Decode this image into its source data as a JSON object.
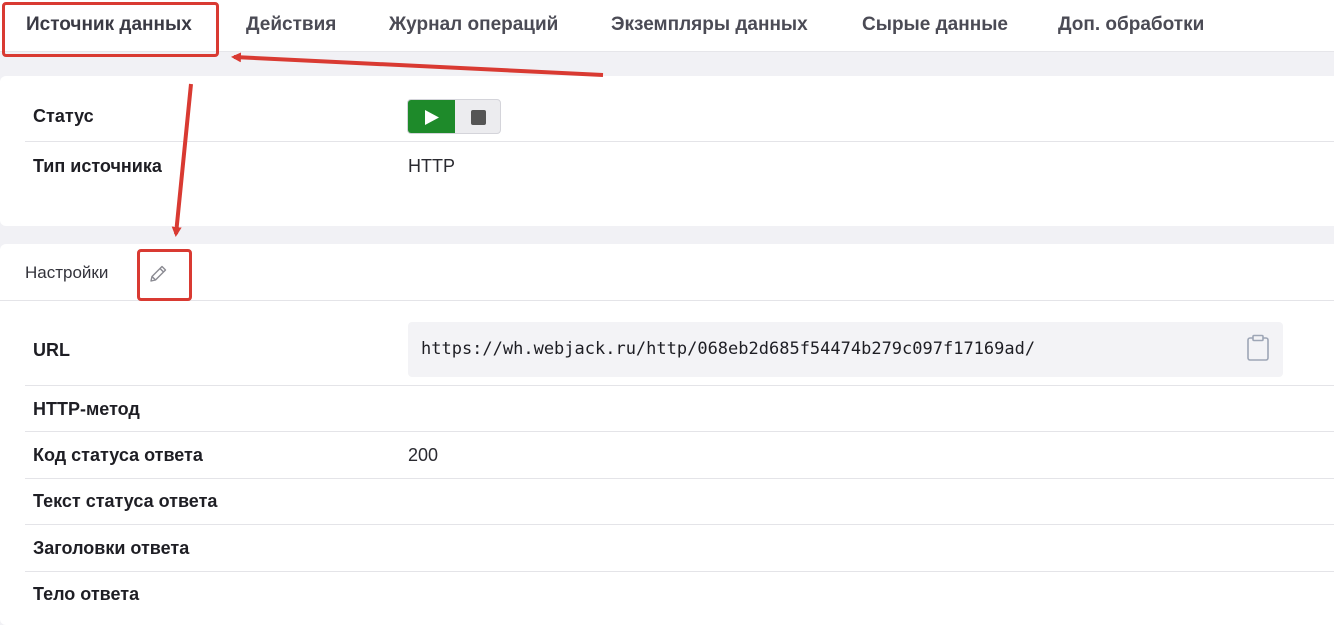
{
  "tabs": [
    {
      "label": "Источник данных",
      "active": true
    },
    {
      "label": "Действия"
    },
    {
      "label": "Журнал операций"
    },
    {
      "label": "Экземпляры данных"
    },
    {
      "label": "Сырые данные"
    },
    {
      "label": "Доп. обработки"
    }
  ],
  "source": {
    "status_label": "Статус",
    "type_label": "Тип источника",
    "type_value": "HTTP"
  },
  "settings": {
    "title": "Настройки",
    "fields": [
      {
        "label": "URL",
        "value": "https://wh.webjack.ru/http/068eb2d685f54474b279c097f17169ad/"
      },
      {
        "label": "HTTP-метод",
        "value": ""
      },
      {
        "label": "Код статуса ответа",
        "value": "200"
      },
      {
        "label": "Текст статуса ответа",
        "value": ""
      },
      {
        "label": "Заголовки ответа",
        "value": ""
      },
      {
        "label": "Тело ответа",
        "value": ""
      }
    ]
  },
  "icons": {
    "play": "play-icon",
    "stop": "stop-icon",
    "edit": "pencil-icon",
    "copy": "clipboard-icon"
  },
  "colors": {
    "play_button": "#1e8a2a",
    "annotation": "#d93a32",
    "background": "#f1f1f5"
  }
}
